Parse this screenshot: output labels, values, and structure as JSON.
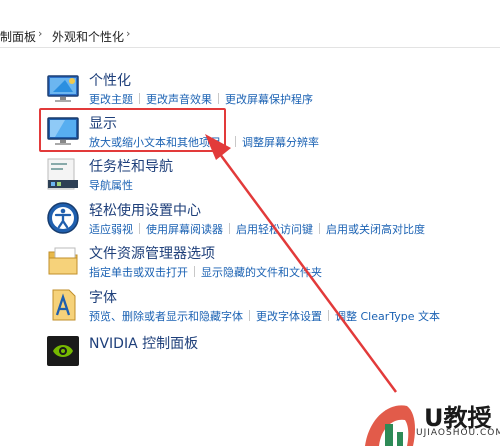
{
  "breadcrumb": {
    "items": [
      "制面板",
      "外观和个性化"
    ]
  },
  "categories": [
    {
      "title": "个性化",
      "links": [
        "更改主题",
        "更改声音效果",
        "更改屏幕保护程序"
      ]
    },
    {
      "title": "显示",
      "links": [
        "放大或缩小文本和其他项目",
        "调整屏幕分辨率"
      ]
    },
    {
      "title": "任务栏和导航",
      "links": [
        "导航属性"
      ]
    },
    {
      "title": "轻松使用设置中心",
      "links": [
        "适应弱视",
        "使用屏幕阅读器",
        "启用轻松访问键",
        "启用或关闭高对比度"
      ]
    },
    {
      "title": "文件资源管理器选项",
      "links": [
        "指定单击或双击打开",
        "显示隐藏的文件和文件夹"
      ]
    },
    {
      "title": "字体",
      "links": [
        "预览、删除或者显示和隐藏字体",
        "更改字体设置",
        "调整 ClearType 文本"
      ]
    },
    {
      "title": "NVIDIA 控制面板",
      "links": []
    }
  ],
  "colors": {
    "title": "#1e3f7a",
    "link": "#1b62b3",
    "highlight": "#e23a3a"
  },
  "watermark": {
    "text": "U教授",
    "sub": "UJIAOSHOU.COM"
  }
}
